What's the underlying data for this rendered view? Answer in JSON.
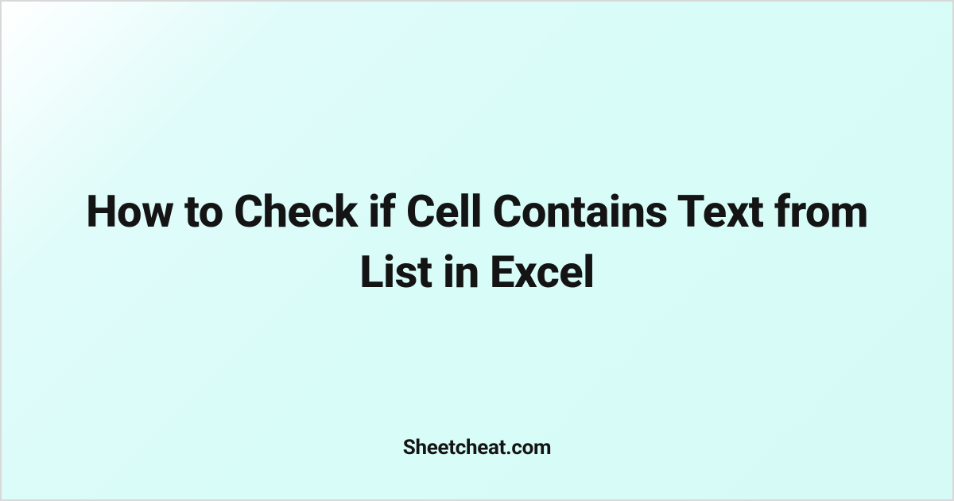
{
  "card": {
    "title": "How to Check if Cell Contains Text from List in Excel",
    "source": "Sheetcheat.com"
  }
}
